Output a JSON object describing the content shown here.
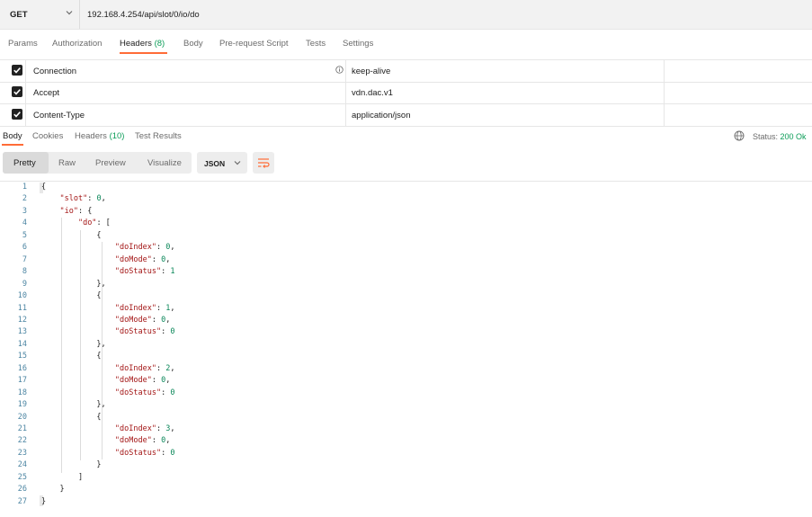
{
  "request": {
    "method": "GET",
    "url": "192.168.4.254/api/slot/0/io/do"
  },
  "request_tabs": [
    {
      "label": "Params"
    },
    {
      "label": "Authorization"
    },
    {
      "label": "Headers",
      "count": "(8)",
      "active": true
    },
    {
      "label": "Body"
    },
    {
      "label": "Pre-request Script"
    },
    {
      "label": "Tests"
    },
    {
      "label": "Settings"
    }
  ],
  "headers": [
    {
      "key": "Connection",
      "value": "keep-alive",
      "checked": true
    },
    {
      "key": "Accept",
      "value": "vdn.dac.v1",
      "checked": true
    },
    {
      "key": "Content-Type",
      "value": "application/json",
      "checked": true
    }
  ],
  "response_tabs": [
    {
      "label": "Body",
      "active": true
    },
    {
      "label": "Cookies"
    },
    {
      "label": "Headers",
      "count": "(10)"
    },
    {
      "label": "Test Results"
    }
  ],
  "status": {
    "label": "Status:",
    "value": "200 Ok"
  },
  "view_modes": [
    "Pretty",
    "Raw",
    "Preview",
    "Visualize"
  ],
  "format": "JSON",
  "icons": {
    "method_dropdown": "chevron-down-icon",
    "header_info": "info-icon",
    "network": "globe-icon",
    "format_dropdown": "chevron-down-icon",
    "wrap": "wrap-lines-icon",
    "checkbox": "checkmark-icon"
  },
  "colors": {
    "accent": "#ff6c37",
    "success": "#0c9d58",
    "json_key": "#a31515",
    "json_number": "#098658",
    "line_number": "#4d86a3"
  },
  "code_lines": [
    "{",
    "    \"slot\": 0,",
    "    \"io\": {",
    "        \"do\": [",
    "            {",
    "                \"doIndex\": 0,",
    "                \"doMode\": 0,",
    "                \"doStatus\": 1",
    "            },",
    "            {",
    "                \"doIndex\": 1,",
    "                \"doMode\": 0,",
    "                \"doStatus\": 0",
    "            },",
    "            {",
    "                \"doIndex\": 2,",
    "                \"doMode\": 0,",
    "                \"doStatus\": 0",
    "            },",
    "            {",
    "                \"doIndex\": 3,",
    "                \"doMode\": 0,",
    "                \"doStatus\": 0",
    "            }",
    "        ]",
    "    }",
    "}"
  ]
}
